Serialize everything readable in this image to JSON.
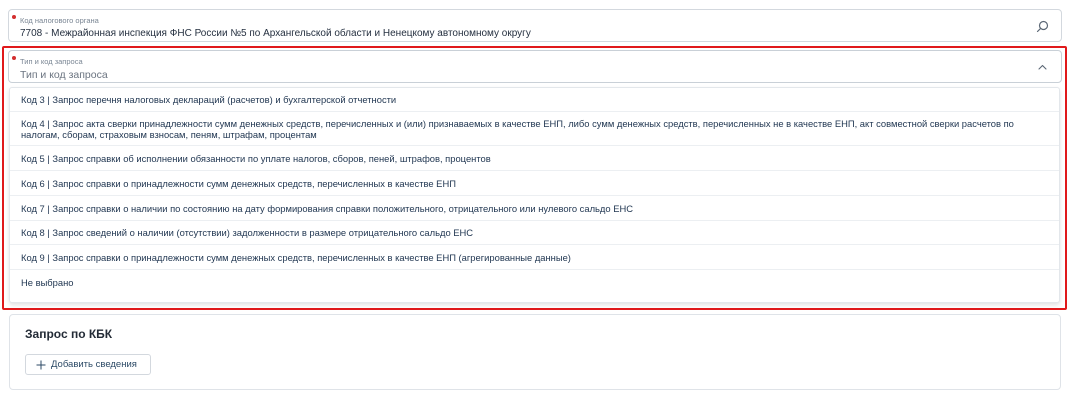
{
  "colors": {
    "required_dot": "#d32f2f",
    "highlight_border": "#e0191b",
    "icon": "#5b6775"
  },
  "tax_authority": {
    "label": "Код налогового органа",
    "value": "7708 - Межрайонная инспекция ФНС России №5 по Архангельской области и Ненецкому автономному округу",
    "icon": "search-icon"
  },
  "request_type": {
    "label": "Тип и код запроса",
    "placeholder": "Тип и код запроса",
    "icon": "chevron-up-icon",
    "options": [
      "Код 3 | Запрос перечня налоговых деклараций (расчетов) и бухгалтерской отчетности",
      "Код 4 | Запрос акта сверки принадлежности сумм денежных средств, перечисленных и (или) признаваемых в качестве ЕНП, либо сумм денежных средств, перечисленных не в качестве ЕНП, акт совместной сверки расчетов по налогам, сборам, страховым взносам, пеням, штрафам, процентам",
      "Код 5 | Запрос справки об исполнении обязанности по уплате налогов, сборов, пеней, штрафов, процентов",
      "Код 6 | Запрос справки о принадлежности сумм денежных средств, перечисленных в качестве ЕНП",
      "Код 7 | Запрос справки о наличии по состоянию на дату формирования справки положительного, отрицательного или нулевого сальдо ЕНС",
      "Код 8 | Запрос сведений о наличии (отсутствии) задолженности в размере отрицательного сальдо ЕНС",
      "Код 9 | Запрос справки о принадлежности сумм денежных средств, перечисленных в качестве ЕНП (агрегированные данные)",
      "Не выбрано"
    ]
  },
  "kbk": {
    "title": "Запрос по КБК",
    "add_label": "Добавить сведения",
    "add_icon": "plus-icon"
  }
}
